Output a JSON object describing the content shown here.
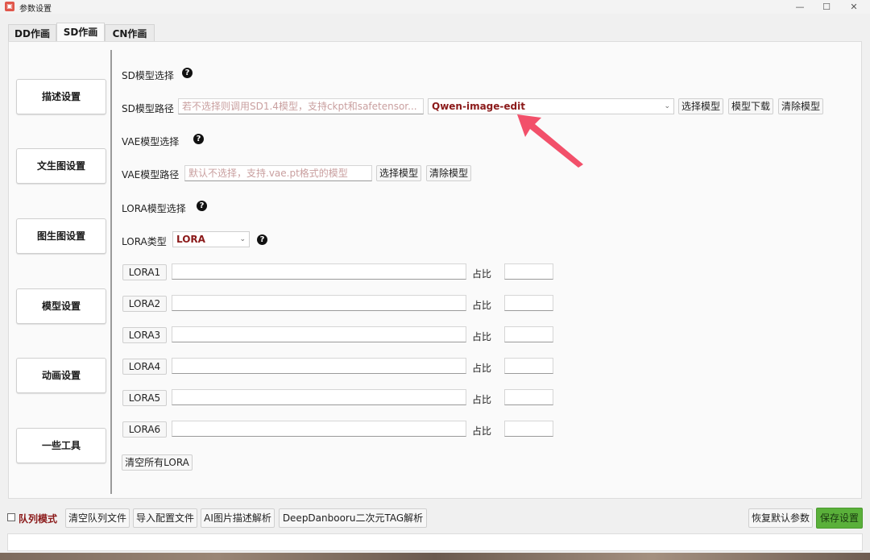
{
  "window": {
    "title": "参数设置",
    "app_icon": "app-logo-icon",
    "controls": [
      "—",
      "☐",
      "✕"
    ]
  },
  "tabs": [
    {
      "label": "DD作画",
      "active": false
    },
    {
      "label": "SD作画",
      "active": true
    },
    {
      "label": "CN作画",
      "active": false
    }
  ],
  "sidebar": {
    "items": [
      {
        "label": "描述设置"
      },
      {
        "label": "文生图设置"
      },
      {
        "label": "图生图设置"
      },
      {
        "label": "模型设置"
      },
      {
        "label": "动画设置"
      },
      {
        "label": "一些工具"
      }
    ]
  },
  "sd_model": {
    "section_title": "SD模型选择",
    "path_label": "SD模型路径",
    "path_placeholder": "若不选择则调用SD1.4模型，支持ckpt和safetensor...",
    "selected_model": "Qwen-image-edit",
    "select_button": "选择模型",
    "download_button": "模型下载",
    "clear_button": "清除模型"
  },
  "vae_model": {
    "section_title": "VAE模型选择",
    "path_label": "VAE模型路径",
    "path_placeholder": "默认不选择，支持.vae.pt格式的模型",
    "select_button": "选择模型",
    "clear_button": "清除模型"
  },
  "lora": {
    "section_title": "LORA模型选择",
    "type_label": "LORA类型",
    "type_value": "LORA",
    "ratio_label": "占比",
    "rows": [
      {
        "name": "LORA1",
        "path": "",
        "ratio": ""
      },
      {
        "name": "LORA2",
        "path": "",
        "ratio": ""
      },
      {
        "name": "LORA3",
        "path": "",
        "ratio": ""
      },
      {
        "name": "LORA4",
        "path": "",
        "ratio": ""
      },
      {
        "name": "LORA5",
        "path": "",
        "ratio": ""
      },
      {
        "name": "LORA6",
        "path": "",
        "ratio": ""
      }
    ],
    "clear_all_button": "清空所有LORA"
  },
  "help_glyph": "?",
  "bottom": {
    "queue_mode_label": "队列模式",
    "queue_mode_checked": false,
    "clear_queue_button": "清空队列文件",
    "import_config_button": "导入配置文件",
    "ai_describe_button": "AI图片描述解析",
    "deepdanbooru_button": "DeepDanbooru二次元TAG解析",
    "restore_defaults_button": "恢复默认参数",
    "save_button": "保存设置",
    "status_text": ""
  },
  "colors": {
    "accent_red": "#8b1a1a",
    "save_green": "#5ab03a",
    "arrow": "#f2506a"
  }
}
